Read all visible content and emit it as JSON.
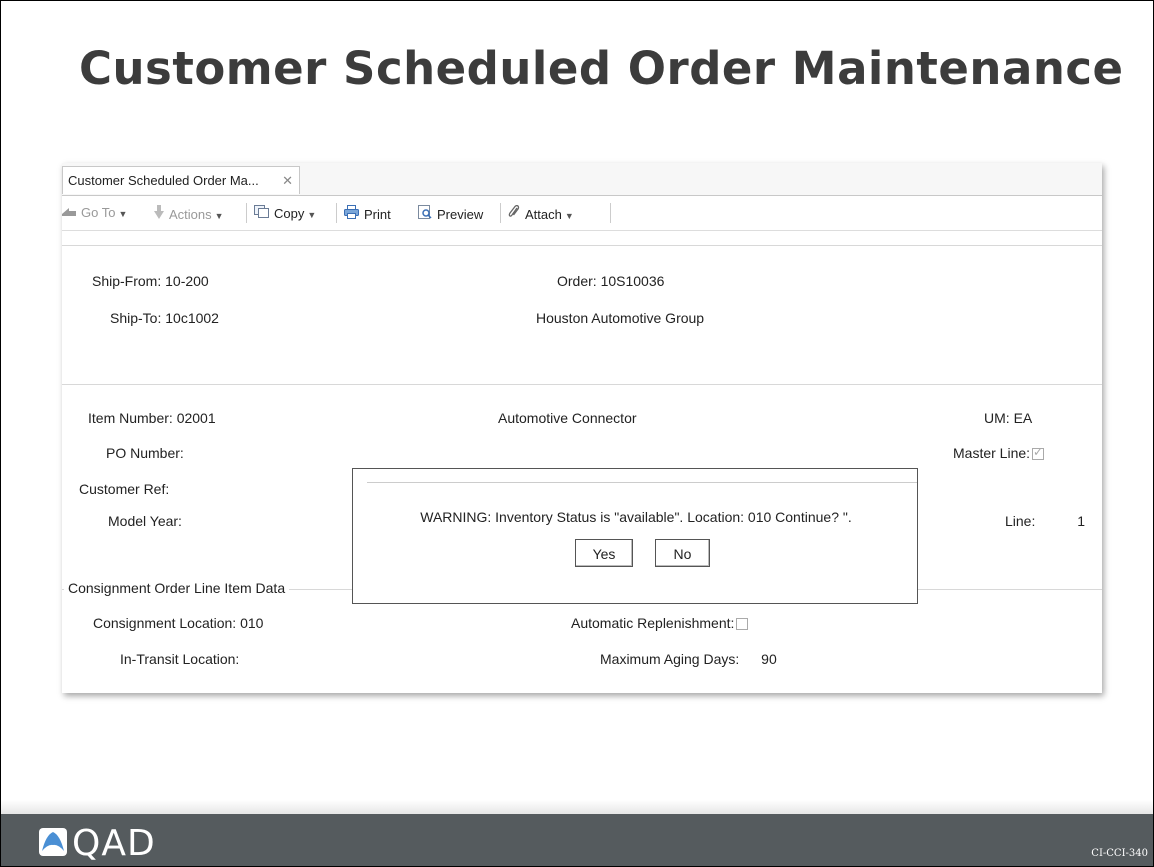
{
  "slide": {
    "title": "Customer Scheduled Order Maintenance",
    "footer_logo": "QAD",
    "footer_code": "CI-CCI-340"
  },
  "tab": {
    "label": "Customer Scheduled Order Ma...",
    "close_glyph": "✕"
  },
  "toolbar": {
    "goto_label": "Go To",
    "actions_label": "Actions",
    "copy_label": "Copy",
    "print_label": "Print",
    "preview_label": "Preview",
    "attach_label": "Attach"
  },
  "header": {
    "ship_from_label": "Ship-From:",
    "ship_from_value": "10-200",
    "order_label": "Order:",
    "order_value": "10S10036",
    "ship_to_label": "Ship-To:",
    "ship_to_value": "10c1002",
    "customer_name": "Houston Automotive Group"
  },
  "line": {
    "item_number_label": "Item Number:",
    "item_number_value": "02001",
    "item_description": "Automotive Connector",
    "um_label": "UM:",
    "um_value": "EA",
    "po_number_label": "PO Number:",
    "master_line_label": "Master Line:",
    "master_line_checked": true,
    "customer_ref_label": "Customer Ref:",
    "model_year_label": "Model Year:",
    "line_label": "Line:",
    "line_value": "1"
  },
  "consignment": {
    "group_label": "Consignment Order Line Item Data",
    "location_label": "Consignment Location:",
    "location_value": "010",
    "auto_replenish_label": "Automatic Replenishment:",
    "auto_replenish_checked": false,
    "in_transit_label": "In-Transit Location:",
    "max_aging_label": "Maximum Aging Days:",
    "max_aging_value": "90"
  },
  "dialog": {
    "message": "WARNING: Inventory Status is \"available\".  Location: 010  Continue? \".",
    "yes_label": "Yes",
    "no_label": "No"
  },
  "colors": {
    "footer_bg": "#555b5e",
    "logo_blue": "#4a8fd4"
  }
}
